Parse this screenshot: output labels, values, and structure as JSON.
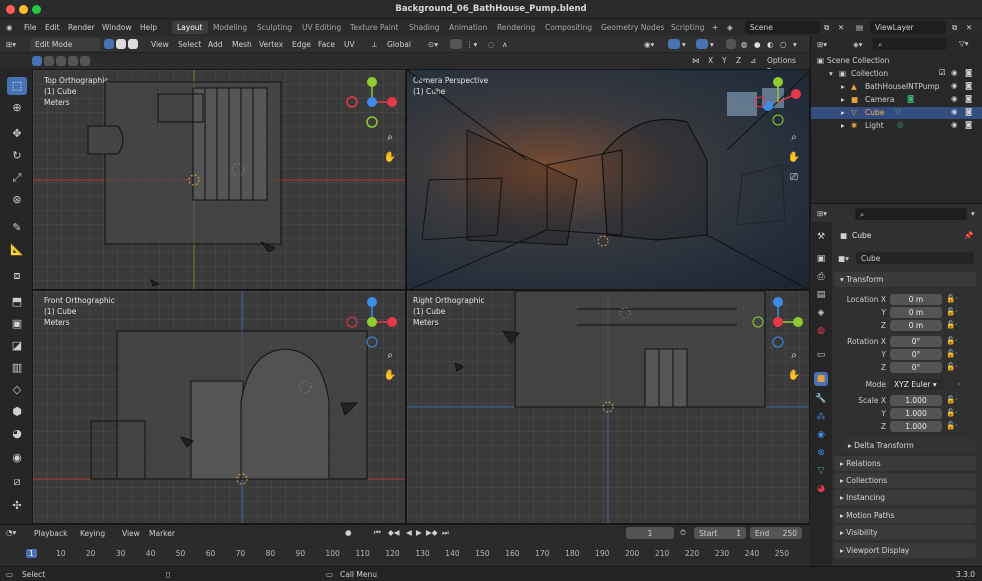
{
  "window": {
    "title": "Background_06_BathHouse_Pump.blend"
  },
  "menu": {
    "items": [
      "File",
      "Edit",
      "Render",
      "Window",
      "Help"
    ]
  },
  "workspace_tabs": [
    "Layout",
    "Modeling",
    "Sculpting",
    "UV Editing",
    "Texture Paint",
    "Shading",
    "Animation",
    "Rendering",
    "Compositing",
    "Geometry Nodes",
    "Scripting"
  ],
  "scene": {
    "name": "Scene",
    "view_layer": "ViewLayer"
  },
  "header": {
    "mode": "Edit Mode",
    "menus": [
      "View",
      "Select",
      "Add",
      "Mesh",
      "Vertex",
      "Edge",
      "Face",
      "UV"
    ],
    "transform_orientation": "Global",
    "axes": [
      "X",
      "Y",
      "Z"
    ],
    "options": "Options"
  },
  "viewports": [
    {
      "name": "Top Orthographic",
      "object": "(1) Cube",
      "units": "Meters"
    },
    {
      "name": "Camera Perspective",
      "object": "(1) Cube",
      "units": ""
    },
    {
      "name": "Front Orthographic",
      "object": "(1) Cube",
      "units": "Meters"
    },
    {
      "name": "Right Orthographic",
      "object": "(1) Cube",
      "units": "Meters"
    }
  ],
  "timeline": {
    "menus": [
      "Playback",
      "Keying",
      "View",
      "Marker"
    ],
    "current_frame": "1",
    "start_label": "Start",
    "start": "1",
    "end_label": "End",
    "end": "250",
    "ticks": [
      "1",
      "10",
      "20",
      "30",
      "40",
      "50",
      "60",
      "70",
      "80",
      "90",
      "100",
      "110",
      "120",
      "130",
      "140",
      "150",
      "160",
      "170",
      "180",
      "190",
      "200",
      "210",
      "220",
      "230",
      "240",
      "250"
    ]
  },
  "status": {
    "left": "Select",
    "middle": "Call Menu",
    "version": "3.3.0"
  },
  "outliner": {
    "root": "Scene Collection",
    "collection": "Collection",
    "items": [
      "BathHouseINTPump",
      "Camera",
      "Cube",
      "Light"
    ],
    "selected": "Cube"
  },
  "properties": {
    "object_name": "Cube",
    "data_name": "Cube",
    "transform_label": "Transform",
    "location_label": "Location X",
    "rotation_label": "Rotation X",
    "scale_label": "Scale X",
    "axis_y": "Y",
    "axis_z": "Z",
    "location": [
      "0 m",
      "0 m",
      "0 m"
    ],
    "rotation": [
      "0°",
      "0°",
      "0°"
    ],
    "mode_label": "Mode",
    "mode": "XYZ Euler",
    "scale": [
      "1.000",
      "1.000",
      "1.000"
    ],
    "delta": "Delta Transform",
    "sections": [
      "Relations",
      "Collections",
      "Instancing",
      "Motion Paths",
      "Visibility",
      "Viewport Display"
    ]
  },
  "colors": {
    "accent": "#4772b3",
    "axis_x": "#e8374b",
    "axis_y": "#8fcc2f",
    "axis_z": "#3d8ce8"
  }
}
